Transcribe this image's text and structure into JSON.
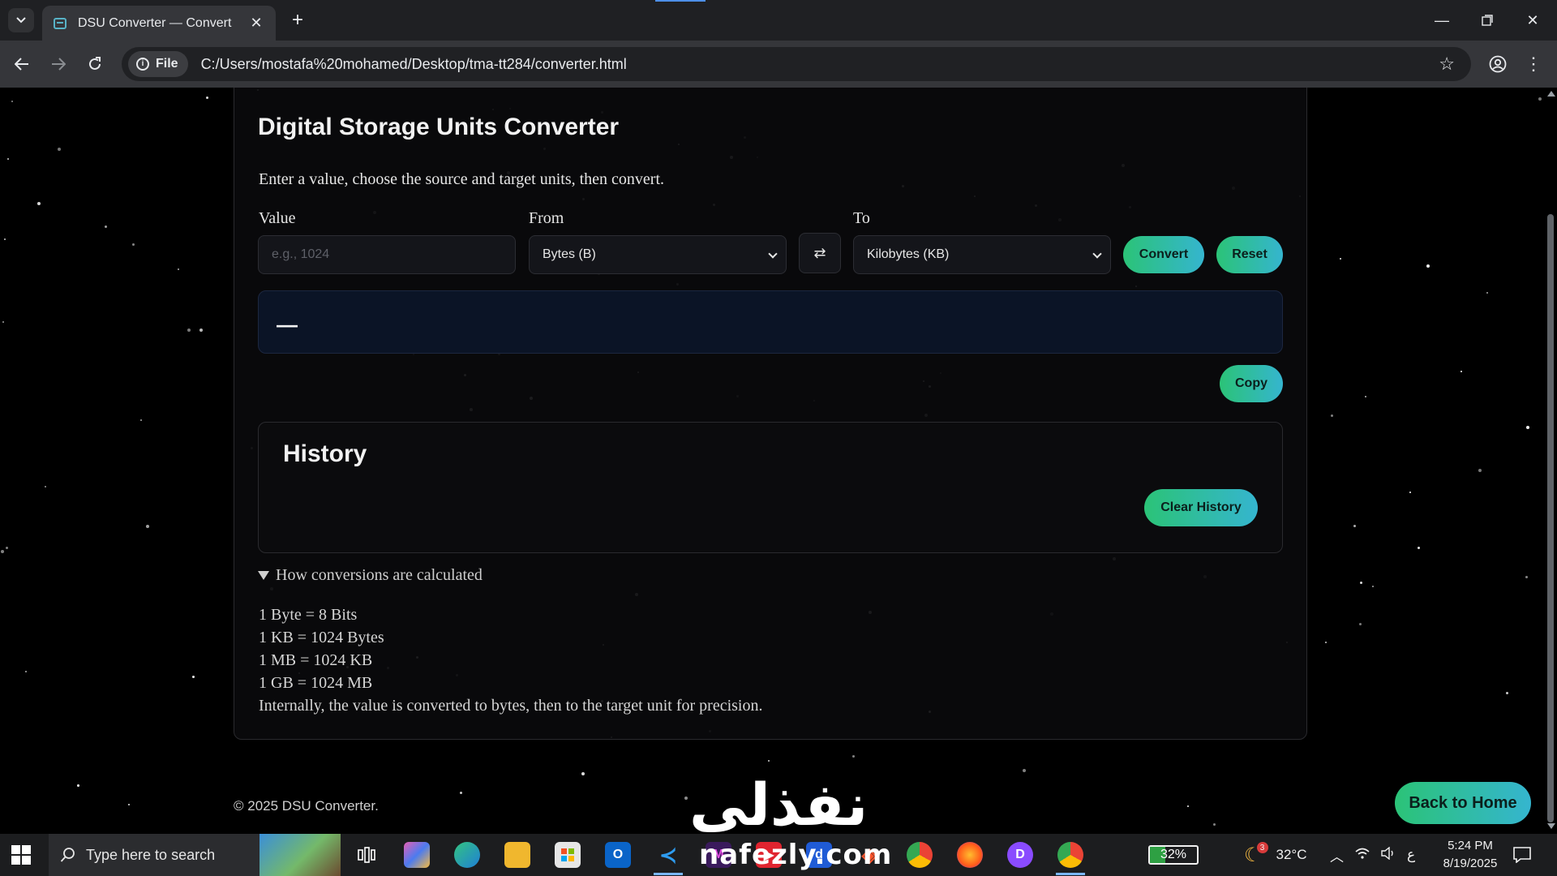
{
  "browser": {
    "tab_title": "DSU Converter — Convert",
    "file_chip": "File",
    "url": "C:/Users/mostafa%20mohamed/Desktop/tma-tt284/converter.html"
  },
  "page": {
    "title": "Digital Storage Units Converter",
    "subtitle": "Enter a value, choose the source and target units, then convert.",
    "value_label": "Value",
    "value_placeholder": "e.g., 1024",
    "from_label": "From",
    "from_selected": "Bytes (B)",
    "to_label": "To",
    "to_selected": "Kilobytes (KB)",
    "swap_glyph": "⇄",
    "convert_label": "Convert",
    "reset_label": "Reset",
    "result_text": "—",
    "copy_label": "Copy",
    "history_title": "History",
    "clear_history_label": "Clear History",
    "details_summary": "How conversions are calculated",
    "details_lines": [
      "1 Byte = 8 Bits",
      "1 KB = 1024 Bytes",
      "1 MB = 1024 KB",
      "1 GB = 1024 MB",
      "Internally, the value is converted to bytes, then to the target unit for precision."
    ],
    "footer": "© 2025 DSU Converter.",
    "back_home_label": "Back to Home"
  },
  "watermark": {
    "arabic": "نفذلي",
    "latin": "nafezly.com"
  },
  "taskbar": {
    "search_placeholder": "Type here to search",
    "battery_percent": 32,
    "battery_label": "32%",
    "weather_badge": "3",
    "temperature": "32°C",
    "lang": "ع",
    "time": "5:24 PM",
    "date": "8/19/2025"
  },
  "colors": {
    "accent_green": "#2bc377",
    "accent_teal": "#35b5cf",
    "result_bg": "#0b1426"
  }
}
